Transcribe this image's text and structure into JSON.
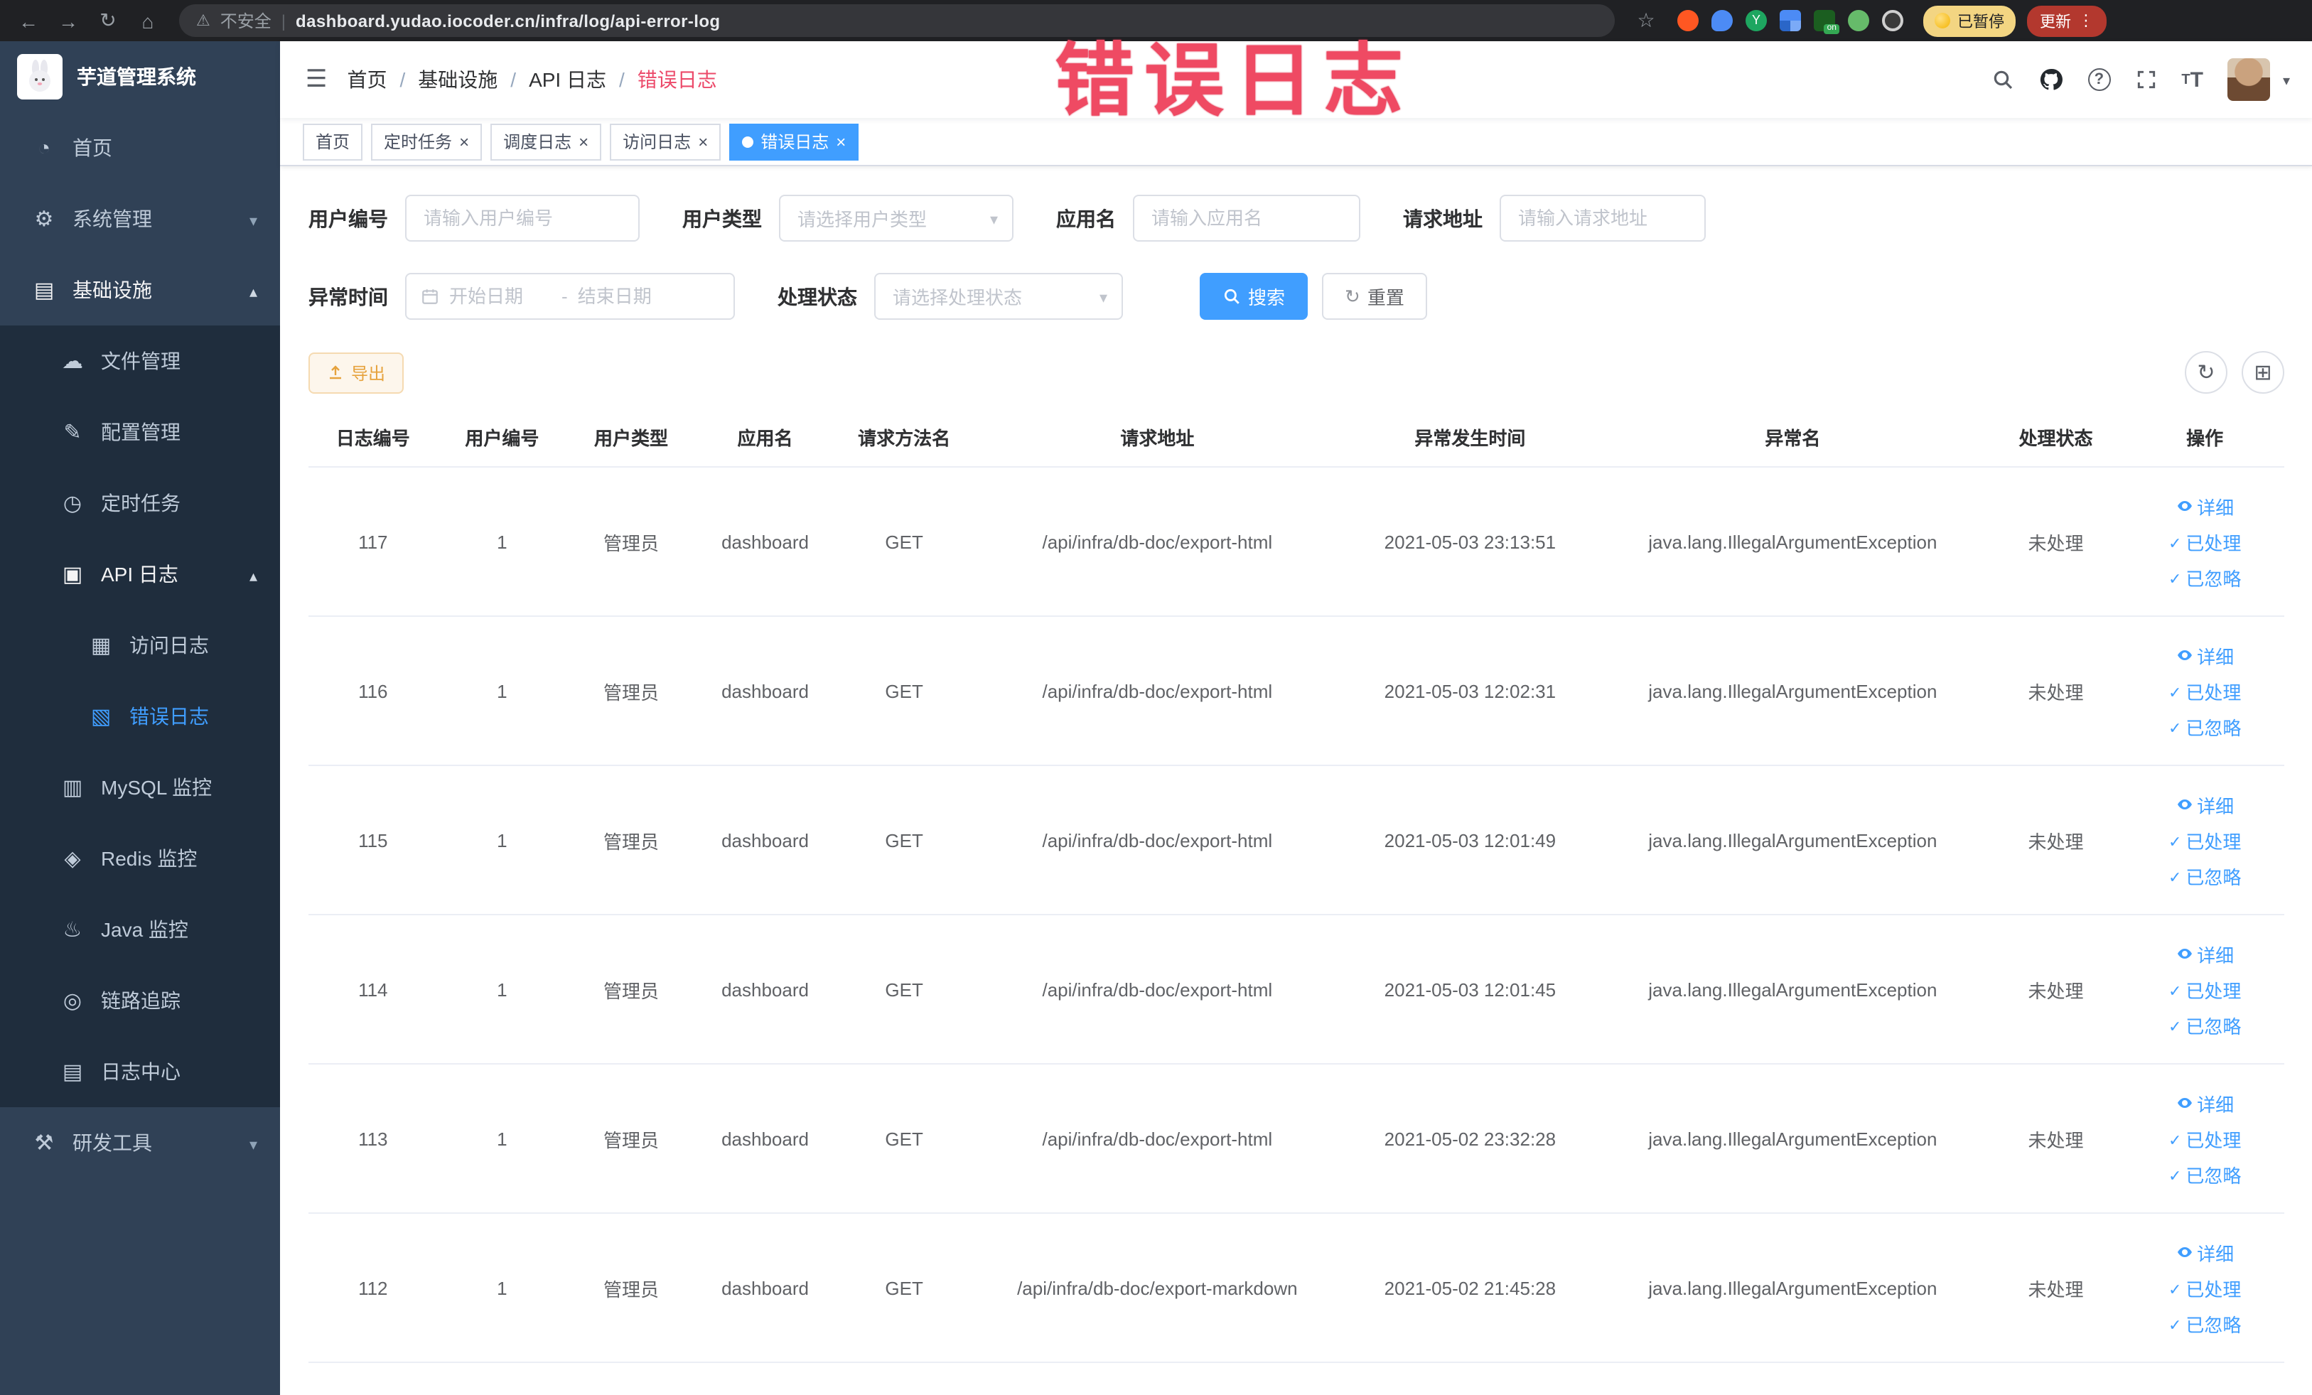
{
  "browser": {
    "security_label": "不安全",
    "url": "dashboard.yudao.iocoder.cn/infra/log/api-error-log",
    "extension_badge": "on",
    "paused_badge": "已暂停",
    "update_button": "更新"
  },
  "annotation_text": "错误日志",
  "sidebar": {
    "logo_title": "芋道管理系统",
    "items": [
      {
        "label": "首页",
        "icon": "◔"
      },
      {
        "label": "系统管理",
        "icon": "⚙"
      },
      {
        "label": "基础设施",
        "icon": "▤"
      },
      {
        "label": "文件管理",
        "icon": "☁"
      },
      {
        "label": "配置管理",
        "icon": "✎"
      },
      {
        "label": "定时任务",
        "icon": "◷"
      },
      {
        "label": "API 日志",
        "icon": "▣"
      },
      {
        "label": "访问日志",
        "icon": "▦"
      },
      {
        "label": "错误日志",
        "icon": "▧"
      },
      {
        "label": "MySQL 监控",
        "icon": "▥"
      },
      {
        "label": "Redis 监控",
        "icon": "◈"
      },
      {
        "label": "Java 监控",
        "icon": "♨"
      },
      {
        "label": "链路追踪",
        "icon": "◎"
      },
      {
        "label": "日志中心",
        "icon": "▤"
      },
      {
        "label": "研发工具",
        "icon": "⚒"
      }
    ]
  },
  "navbar": {
    "breadcrumb": [
      "首页",
      "基础设施",
      "API 日志",
      "错误日志"
    ]
  },
  "tags": [
    {
      "label": "首页"
    },
    {
      "label": "定时任务"
    },
    {
      "label": "调度日志"
    },
    {
      "label": "访问日志"
    },
    {
      "label": "错误日志"
    }
  ],
  "filters": {
    "user_id_label": "用户编号",
    "user_id_placeholder": "请输入用户编号",
    "user_type_label": "用户类型",
    "user_type_placeholder": "请选择用户类型",
    "app_name_label": "应用名",
    "app_name_placeholder": "请输入应用名",
    "request_url_label": "请求地址",
    "request_url_placeholder": "请输入请求地址",
    "time_label": "异常时间",
    "time_start_placeholder": "开始日期",
    "time_separator": "-",
    "time_end_placeholder": "结束日期",
    "status_label": "处理状态",
    "status_placeholder": "请选择处理状态",
    "search_button": "搜索",
    "reset_button": "重置"
  },
  "toolbar": {
    "export_button": "导出"
  },
  "table": {
    "headers": [
      "日志编号",
      "用户编号",
      "用户类型",
      "应用名",
      "请求方法名",
      "请求地址",
      "异常发生时间",
      "异常名",
      "处理状态",
      "操作"
    ],
    "row_actions": {
      "detail": "详细",
      "processed": "已处理",
      "ignored": "已忽略"
    },
    "rows": [
      {
        "log_id": "117",
        "user_id": "1",
        "user_type": "管理员",
        "app_name": "dashboard",
        "method": "GET",
        "request_url": "/api/infra/db-doc/export-html",
        "time": "2021-05-03 23:13:51",
        "exception": "java.lang.IllegalArgumentException",
        "status": "未处理"
      },
      {
        "log_id": "116",
        "user_id": "1",
        "user_type": "管理员",
        "app_name": "dashboard",
        "method": "GET",
        "request_url": "/api/infra/db-doc/export-html",
        "time": "2021-05-03 12:02:31",
        "exception": "java.lang.IllegalArgumentException",
        "status": "未处理"
      },
      {
        "log_id": "115",
        "user_id": "1",
        "user_type": "管理员",
        "app_name": "dashboard",
        "method": "GET",
        "request_url": "/api/infra/db-doc/export-html",
        "time": "2021-05-03 12:01:49",
        "exception": "java.lang.IllegalArgumentException",
        "status": "未处理"
      },
      {
        "log_id": "114",
        "user_id": "1",
        "user_type": "管理员",
        "app_name": "dashboard",
        "method": "GET",
        "request_url": "/api/infra/db-doc/export-html",
        "time": "2021-05-03 12:01:45",
        "exception": "java.lang.IllegalArgumentException",
        "status": "未处理"
      },
      {
        "log_id": "113",
        "user_id": "1",
        "user_type": "管理员",
        "app_name": "dashboard",
        "method": "GET",
        "request_url": "/api/infra/db-doc/export-html",
        "time": "2021-05-02 23:32:28",
        "exception": "java.lang.IllegalArgumentException",
        "status": "未处理"
      },
      {
        "log_id": "112",
        "user_id": "1",
        "user_type": "管理员",
        "app_name": "dashboard",
        "method": "GET",
        "request_url": "/api/infra/db-doc/export-markdown",
        "time": "2021-05-02 21:45:28",
        "exception": "java.lang.IllegalArgumentException",
        "status": "未处理"
      }
    ]
  }
}
